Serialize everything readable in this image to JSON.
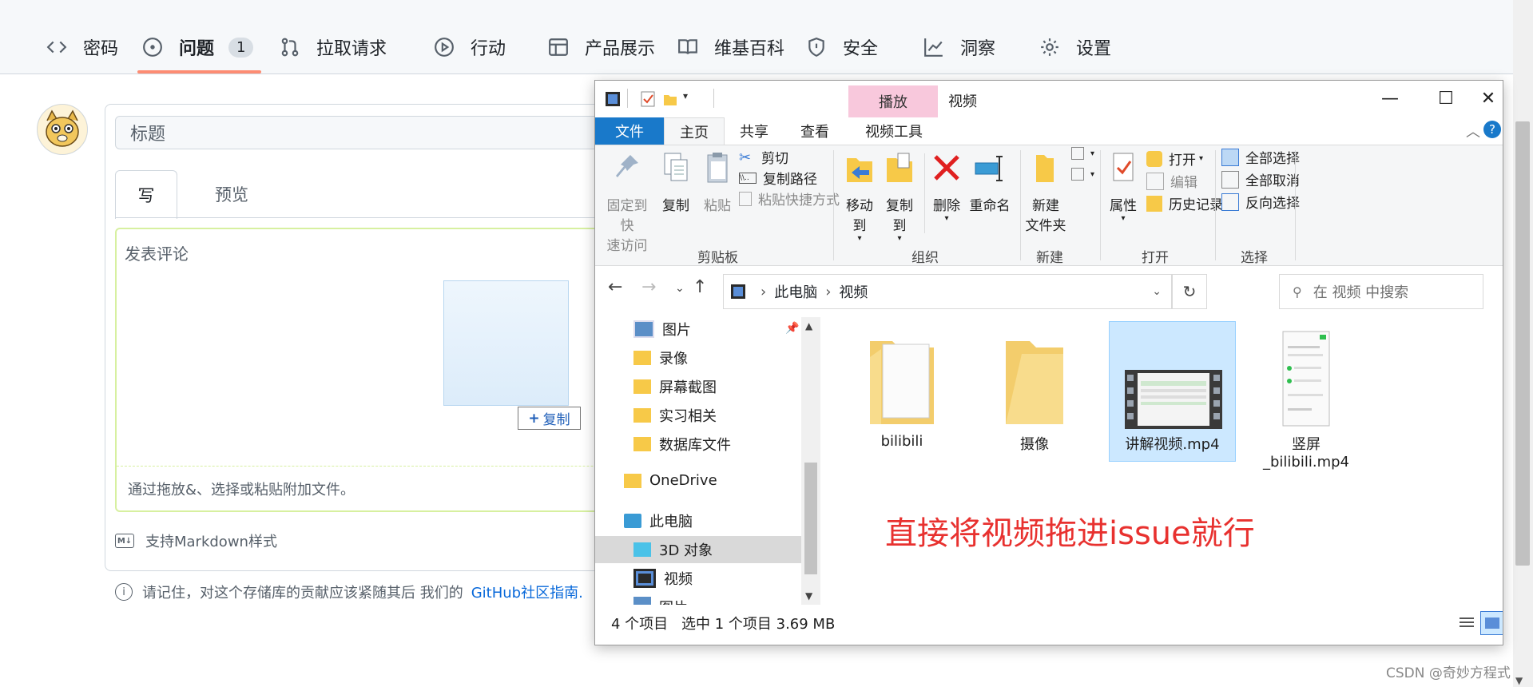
{
  "github": {
    "nav": [
      {
        "label": "密码",
        "icon": "code-icon"
      },
      {
        "label": "问题",
        "icon": "issue-icon",
        "count": "1"
      },
      {
        "label": "拉取请求",
        "icon": "pull-request-icon"
      },
      {
        "label": "行动",
        "icon": "play-icon"
      },
      {
        "label": "产品展示",
        "icon": "table-icon"
      },
      {
        "label": "维基百科",
        "icon": "book-icon"
      },
      {
        "label": "安全",
        "icon": "shield-icon"
      },
      {
        "label": "洞察",
        "icon": "graph-icon"
      },
      {
        "label": "设置",
        "icon": "gear-icon"
      }
    ],
    "title_placeholder": "标题",
    "tab_write": "写",
    "tab_preview": "预览",
    "comment_placeholder": "发表评论",
    "copy_badge": "复制",
    "attach_hint": "通过拖放&、选择或粘贴附加文件。",
    "markdown_hint": "支持Markdown样式",
    "note_text": "请记住，对这个存储库的贡献应该紧随其后 我们的",
    "note_link": "GitHub社区指南."
  },
  "explorer": {
    "title": "视频",
    "context_tab": "播放",
    "ribbon_tabs": [
      "文件",
      "主页",
      "共享",
      "查看",
      "视频工具"
    ],
    "clipboard": {
      "pin": [
        "固定到快",
        "速访问"
      ],
      "copy": "复制",
      "paste": "粘贴",
      "cut": "剪切",
      "copy_path": "复制路径",
      "paste_shortcut": "粘贴快捷方式",
      "label": "剪贴板"
    },
    "organize": {
      "move_to": "移动到",
      "copy_to": "复制到",
      "delete": "删除",
      "rename": "重命名",
      "label": "组织"
    },
    "new": {
      "new_folder": [
        "新建",
        "文件夹"
      ],
      "label": "新建"
    },
    "open": {
      "properties": "属性",
      "open": "打开",
      "edit": "编辑",
      "history": "历史记录",
      "label": "打开"
    },
    "select": {
      "select_all": "全部选择",
      "select_none": "全部取消",
      "invert": "反向选择",
      "label": "选择"
    },
    "breadcrumb": [
      "此电脑",
      "视频"
    ],
    "search_placeholder": "在 视频 中搜索",
    "tree": [
      "图片",
      "录像",
      "屏幕截图",
      "实习相关",
      "数据库文件",
      "OneDrive",
      "此电脑",
      "3D 对象",
      "视频",
      "图片"
    ],
    "files": [
      {
        "name": "bilibili",
        "kind": "folder-with-doc"
      },
      {
        "name": "摄像",
        "kind": "folder"
      },
      {
        "name": "讲解视频.mp4",
        "kind": "video"
      },
      {
        "name": "竖屏_bilibili.mp4",
        "name_lines": [
          "竖屏",
          "_bilibili.mp4"
        ],
        "kind": "phone-video"
      }
    ],
    "status_count": "4 个项目",
    "status_selected": "选中 1 个项目  3.69 MB"
  },
  "annotation": "直接将视频拖进issue就行",
  "watermark": "CSDN @奇妙方程式"
}
